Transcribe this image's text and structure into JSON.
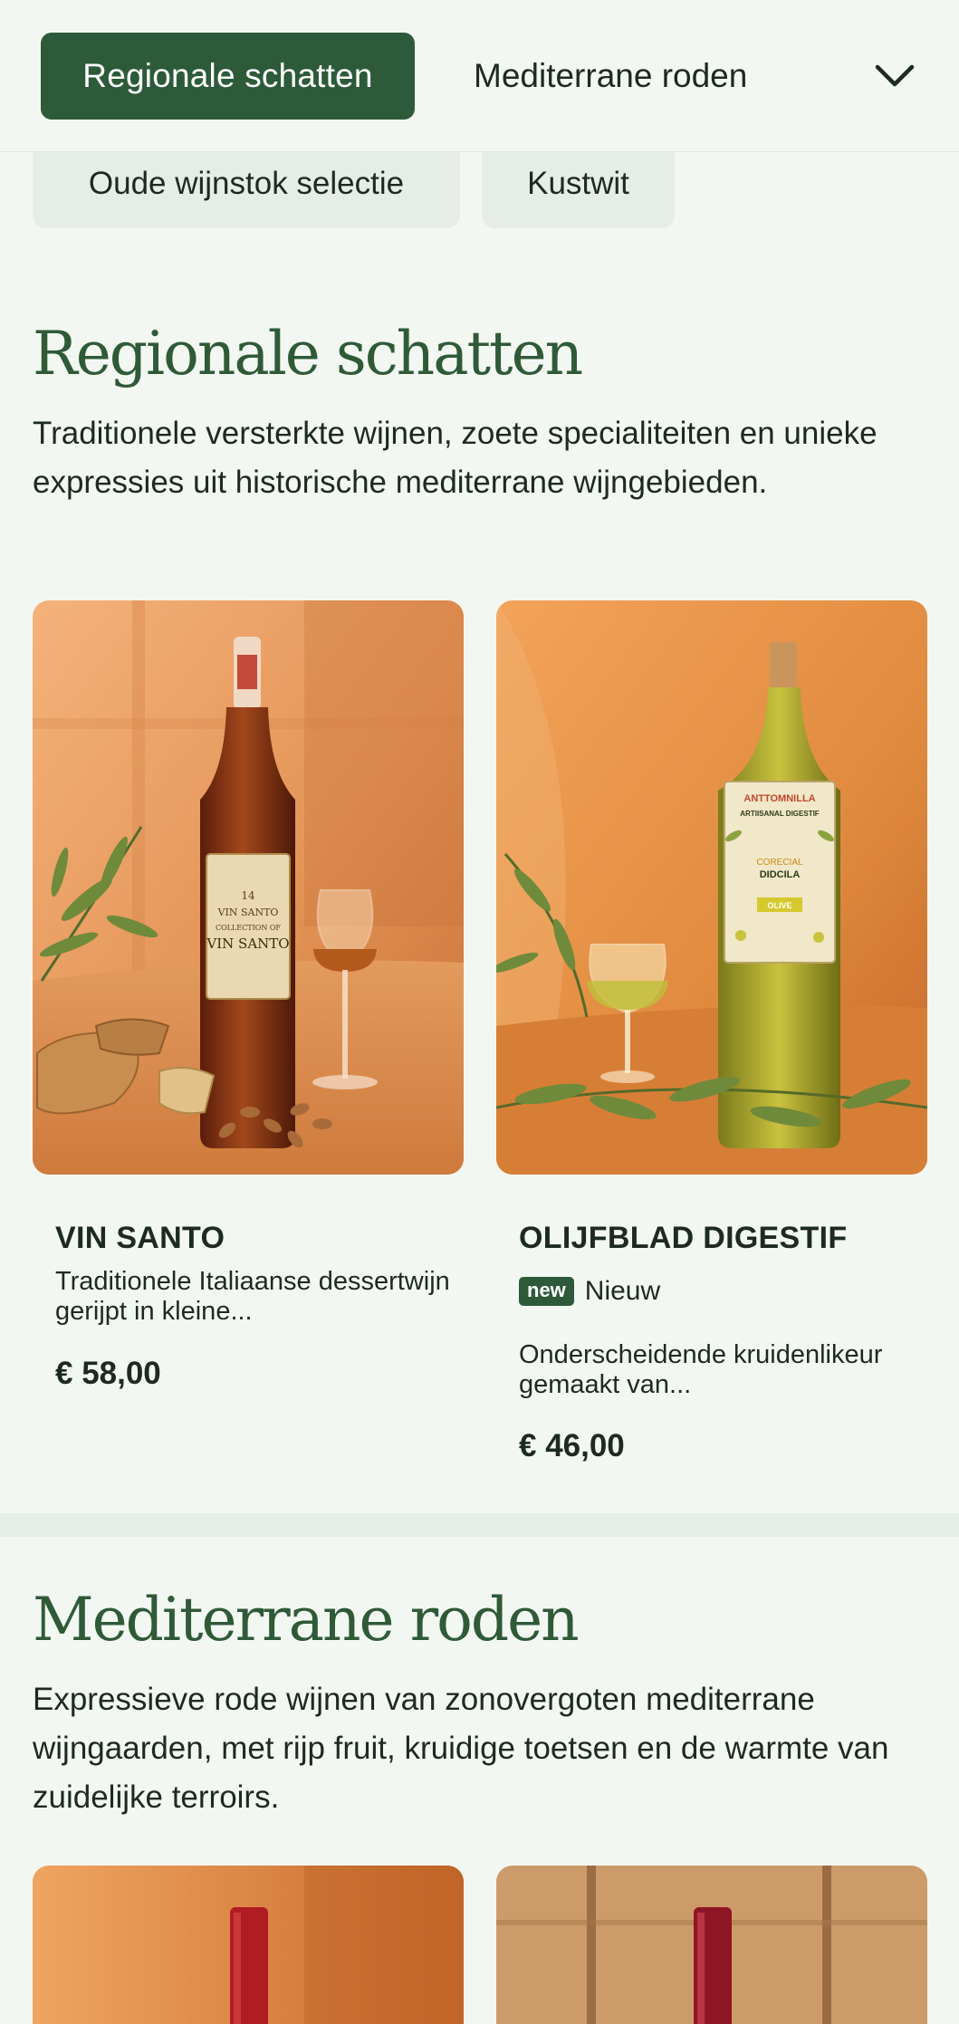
{
  "category_nav": {
    "active": "Regionale schatten",
    "next": "Mediterrane roden",
    "chips": [
      "Oude wijnstok selectie",
      "Kustwit"
    ]
  },
  "sections": [
    {
      "title": "Regionale schatten",
      "description": "Traditionele versterkte wijnen, zoete specialiteiten en unieke expressies uit historische mediterrane wijngebieden.",
      "products": [
        {
          "name": "VIN SANTO",
          "description": "Traditionele Italiaanse dessertwijn gerijpt in kleine...",
          "price": "€ 58,00",
          "label_lines": [
            "14",
            "VIN SANTO",
            "COLLECTION OF",
            "VIN SANTO"
          ]
        },
        {
          "name": "OLIJFBLAD DIGESTIF",
          "badge": "new",
          "badge_text": "Nieuw",
          "description": "Onderscheidende kruidenlikeur gemaakt van...",
          "price": "€ 46,00",
          "label_lines": [
            "ANTTOMNILLA",
            "ARTIISANAL DIGESTIF",
            "CORECIAL",
            "DIDCILA",
            "OLIVE"
          ]
        }
      ]
    },
    {
      "title": "Mediterrane roden",
      "description": "Expressieve rode wijnen van zonovergoten mediterrane wijngaarden, met rijp fruit, kruidige toetsen en de warmte van zuidelijke terroirs."
    }
  ],
  "colors": {
    "accent": "#2d5a39",
    "heading": "#2f5a38",
    "background": "#f3f7f2",
    "chip": "#e6ede6"
  },
  "icons": {
    "nav_toggle": "chevron-down-icon"
  }
}
